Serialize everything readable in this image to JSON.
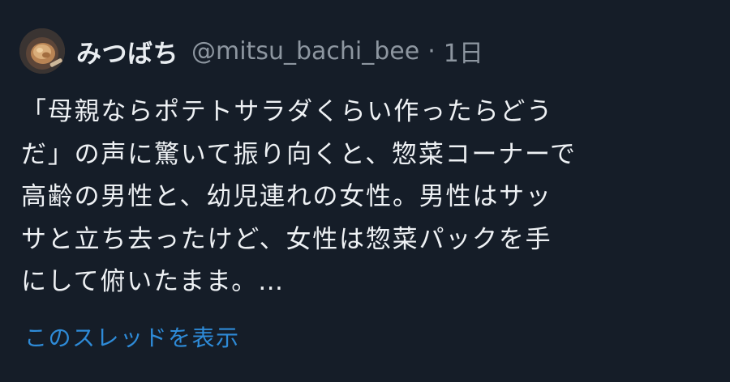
{
  "tweet": {
    "author_name": "みつばち",
    "handle": "@mitsu_bachi_bee",
    "separator": "·",
    "timestamp": "1日",
    "text_lines": [
      "「母親ならポテトサラダくらい作ったらどう",
      "だ」の声に驚いて振り向くと、惣菜コーナーで",
      "高齢の男性と、幼児連れの女性。男性はサッ",
      "サと立ち去ったけど、女性は惣菜パックを手",
      "にして俯いたまま。…"
    ],
    "show_thread_label": "このスレッドを表示"
  },
  "colors": {
    "background": "#151d28",
    "primary_text": "#eef1f4",
    "secondary_text": "#8d96a0",
    "link": "#2e8bd8"
  },
  "icons": {
    "avatar": "avatar-photo-icon"
  }
}
